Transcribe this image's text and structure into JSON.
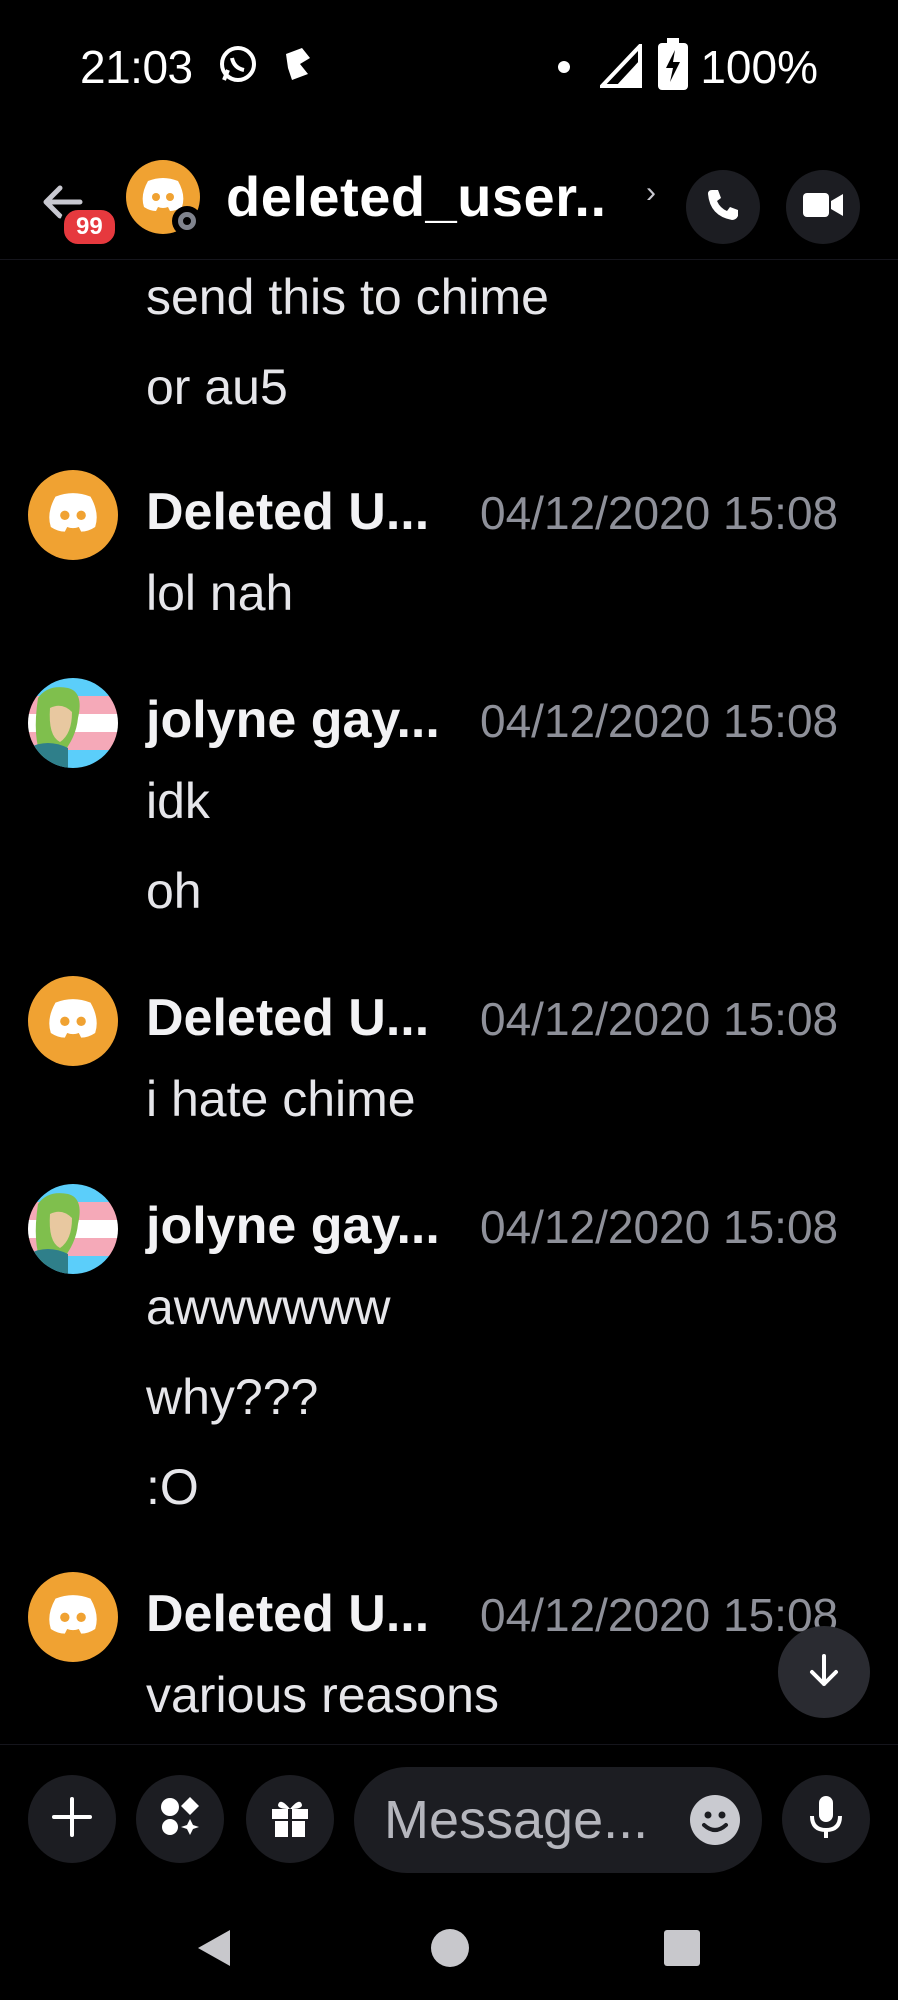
{
  "status_bar": {
    "time": "21:03",
    "battery_text": "100%",
    "icons": [
      "whatsapp-icon",
      "notification-icon",
      "dot-icon",
      "signal-icon",
      "battery-charging-icon"
    ]
  },
  "header": {
    "back_badge": "99",
    "title": "deleted_user..",
    "chevron": "›",
    "icons": [
      "back-arrow-icon",
      "voice-call-icon",
      "video-call-icon"
    ]
  },
  "messages": {
    "continued": [
      "send this to chime",
      "or au5"
    ],
    "groups": [
      {
        "author": "Deleted U...",
        "timestamp": "04/12/2020 15:08",
        "avatar": "discord",
        "lines": [
          "lol nah"
        ]
      },
      {
        "author": "jolyne gay...",
        "timestamp": "04/12/2020 15:08",
        "avatar": "jolyne",
        "lines": [
          "idk",
          "oh"
        ]
      },
      {
        "author": "Deleted U...",
        "timestamp": "04/12/2020 15:08",
        "avatar": "discord",
        "lines": [
          "i hate chime"
        ]
      },
      {
        "author": "jolyne gay...",
        "timestamp": "04/12/2020 15:08",
        "avatar": "jolyne",
        "lines": [
          "awwwwww",
          "why???",
          ":O"
        ]
      },
      {
        "author": "Deleted U...",
        "timestamp": "04/12/2020 15:08",
        "avatar": "discord",
        "lines": [
          "various reasons"
        ]
      }
    ]
  },
  "composer": {
    "placeholder": "Message...",
    "icons": [
      "plus-icon",
      "apps-icon",
      "gift-icon",
      "emoji-icon",
      "microphone-icon"
    ]
  },
  "nav": {
    "icons": [
      "back-triangle-icon",
      "home-circle-icon",
      "recents-square-icon"
    ]
  },
  "colors": {
    "background": "#000000",
    "accent_badge": "#e6393e",
    "discord_avatar": "#f0a232",
    "timestamp": "#8e9099",
    "control_bg": "#1c1d22"
  }
}
